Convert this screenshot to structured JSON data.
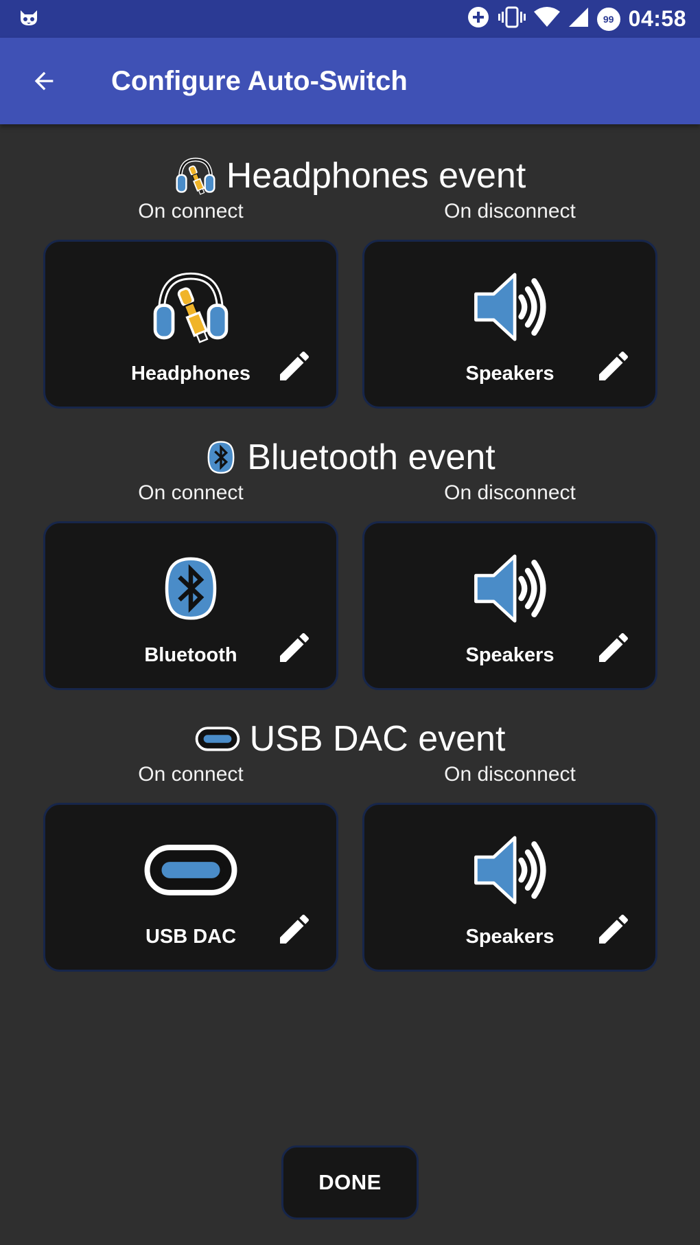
{
  "status_bar": {
    "time": "04:58",
    "badge": "99"
  },
  "app_bar": {
    "title": "Configure Auto-Switch",
    "back_icon": "arrow-back-icon"
  },
  "sections": [
    {
      "title": "Headphones event",
      "icon": "headphones-icon",
      "on_connect_label": "On connect",
      "on_disconnect_label": "On disconnect",
      "connect": {
        "label": "Headphones",
        "icon": "headphones-icon"
      },
      "disconnect": {
        "label": "Speakers",
        "icon": "speaker-icon"
      }
    },
    {
      "title": "Bluetooth event",
      "icon": "bluetooth-icon",
      "on_connect_label": "On connect",
      "on_disconnect_label": "On disconnect",
      "connect": {
        "label": "Bluetooth",
        "icon": "bluetooth-icon"
      },
      "disconnect": {
        "label": "Speakers",
        "icon": "speaker-icon"
      }
    },
    {
      "title": "USB DAC event",
      "icon": "usb-c-icon",
      "on_connect_label": "On connect",
      "on_disconnect_label": "On disconnect",
      "connect": {
        "label": "USB DAC",
        "icon": "usb-c-icon"
      },
      "disconnect": {
        "label": "Speakers",
        "icon": "speaker-icon"
      }
    }
  ],
  "done_label": "DONE",
  "colors": {
    "status_bar": "#2b3a94",
    "app_bar": "#3f51b5",
    "background": "#2f2f2f",
    "card": "#161616",
    "card_border": "#17264a",
    "icon_blue": "#4a8cc8",
    "jack_gold": "#f0b429"
  }
}
